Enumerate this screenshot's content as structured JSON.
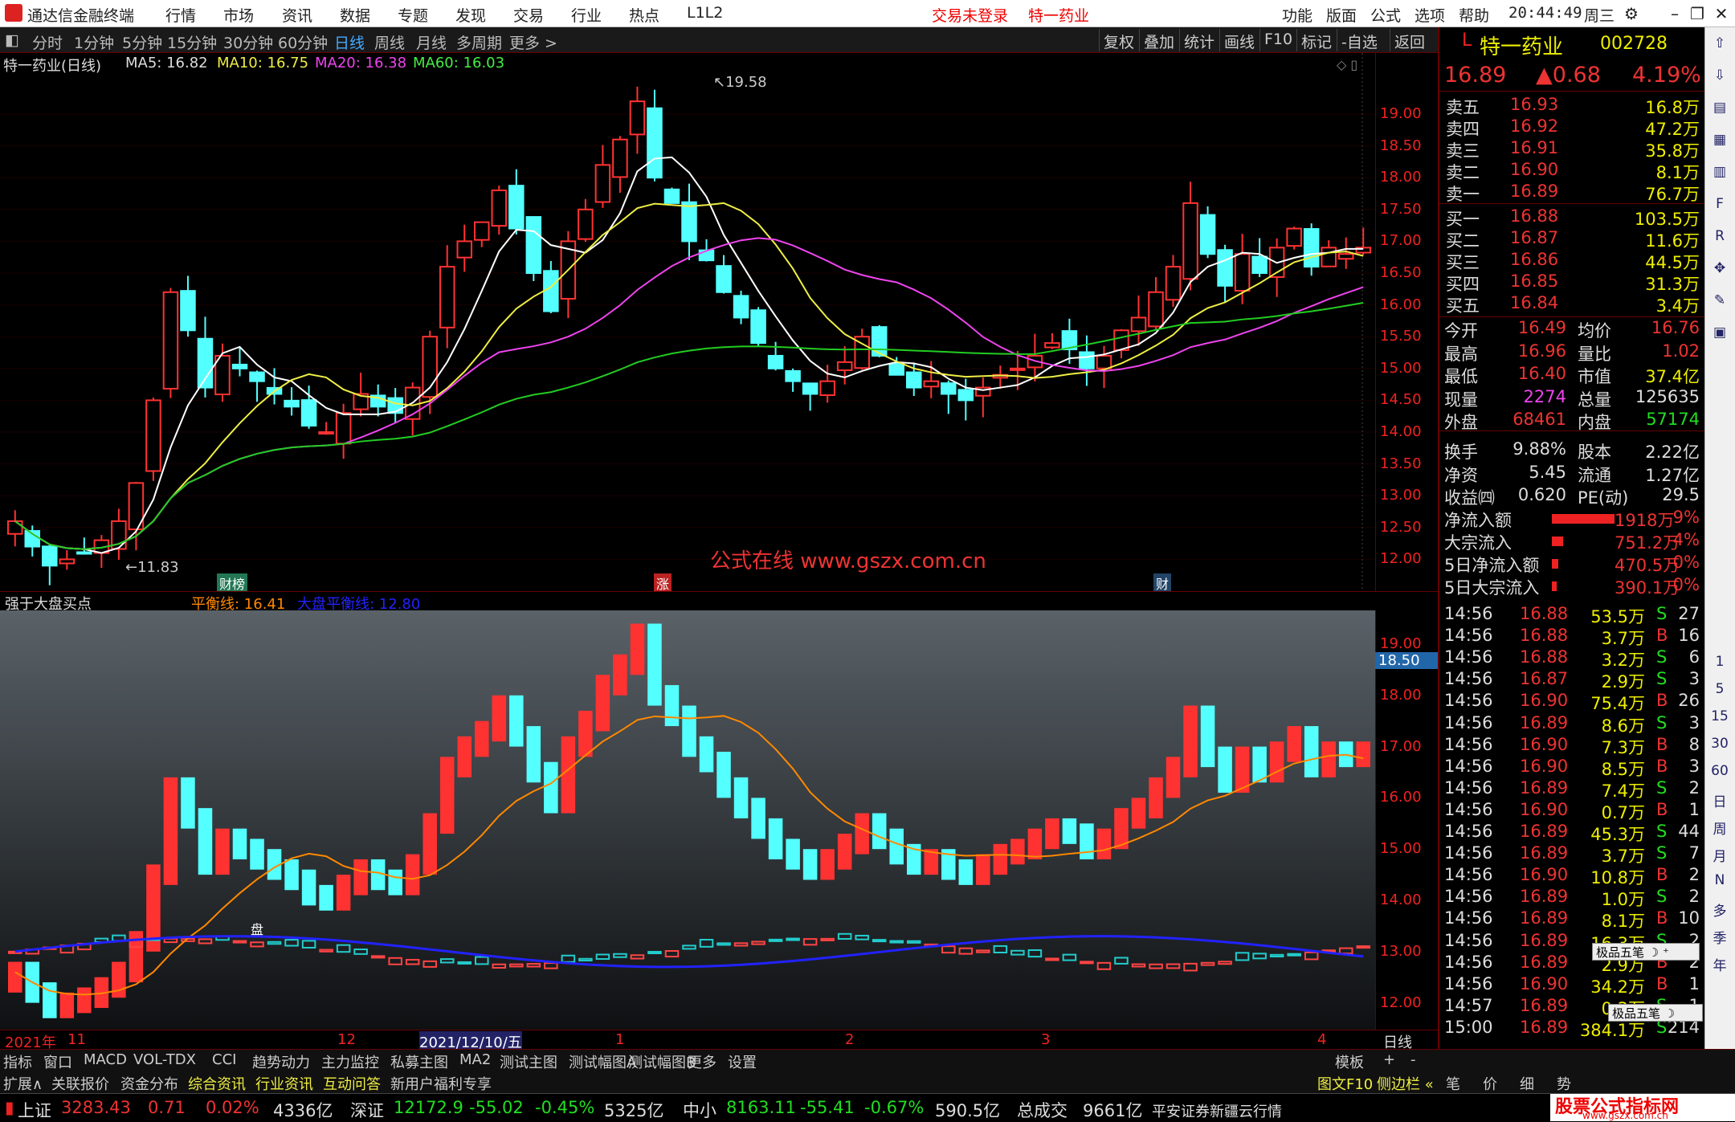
{
  "titlebar": {
    "app": "通达信金融终端",
    "menus": [
      "行情",
      "市场",
      "资讯",
      "数据",
      "专题",
      "发现",
      "交易",
      "行业",
      "热点",
      "L1L2"
    ],
    "notice": "交易未登录",
    "stock_tag": "特一药业",
    "right_menus": [
      "功能",
      "版面",
      "公式",
      "选项",
      "帮助"
    ],
    "time": "20:44:49",
    "weekday": "周三"
  },
  "periods": [
    "分时",
    "1分钟",
    "5分钟",
    "15分钟",
    "30分钟",
    "60分钟",
    "日线",
    "周线",
    "月线",
    "多周期",
    "更多 >"
  ],
  "tools": [
    "复权",
    "叠加",
    "统计",
    "画线",
    "F10",
    "标记",
    "-自选",
    "返回"
  ],
  "main": {
    "stock": "特一药业(日线)",
    "ma5": "MA5: 16.82",
    "ma10": "MA10: 16.75",
    "ma20": "MA20: 16.38",
    "ma60": "MA60: 16.03",
    "high_label": "19.58",
    "low_label": "11.83",
    "watermark": "公式在线  www.gszx.com.cn",
    "markers": [
      "财榜",
      "涨",
      "财"
    ],
    "axis": [
      "19.00",
      "18.50",
      "18.00",
      "17.50",
      "17.00",
      "16.50",
      "16.00",
      "15.50",
      "15.00",
      "14.50",
      "14.00",
      "13.50",
      "13.00",
      "12.50",
      "12.00"
    ]
  },
  "indicator": {
    "name": "强于大盘买点",
    "balance": "平衡线: 16.41",
    "market": "大盘平衡线: 12.80",
    "axis": [
      "19.00",
      "18.00",
      "17.00",
      "16.00",
      "15.00",
      "14.00",
      "13.00",
      "12.00"
    ],
    "cursor_price": "18.50",
    "pan_label": "盘"
  },
  "dates": {
    "year": "2021年",
    "m11": "11",
    "m12": "12",
    "cursor": "2021/12/10/五",
    "m1": "1",
    "m2": "2",
    "m3": "3",
    "m4": "4",
    "period": "日线"
  },
  "quote": {
    "prefix": "L",
    "name": "特一药业",
    "code": "002728",
    "price": "16.89",
    "change": "▲0.68",
    "pct": "4.19%",
    "asks": [
      [
        "卖五",
        "16.93",
        "16.8万"
      ],
      [
        "卖四",
        "16.92",
        "47.2万"
      ],
      [
        "卖三",
        "16.91",
        "35.8万"
      ],
      [
        "卖二",
        "16.90",
        "8.1万"
      ],
      [
        "卖一",
        "16.89",
        "76.7万"
      ]
    ],
    "bids": [
      [
        "买一",
        "16.88",
        "103.5万"
      ],
      [
        "买二",
        "16.87",
        "11.6万"
      ],
      [
        "买三",
        "16.86",
        "44.5万"
      ],
      [
        "买四",
        "16.85",
        "31.3万"
      ],
      [
        "买五",
        "16.84",
        "3.4万"
      ]
    ],
    "stats": [
      [
        "今开",
        "16.49",
        "均价",
        "16.76"
      ],
      [
        "最高",
        "16.96",
        "量比",
        "1.02"
      ],
      [
        "最低",
        "16.40",
        "市值",
        "37.4亿"
      ],
      [
        "现量",
        "2274",
        "总量",
        "125635"
      ],
      [
        "外盘",
        "68461",
        "内盘",
        "57174"
      ],
      [
        "换手",
        "9.88%",
        "股本",
        "2.22亿"
      ],
      [
        "净资",
        "5.45",
        "流通",
        "1.27亿"
      ],
      [
        "收益㈣",
        "0.620",
        "PE(动)",
        "29.5"
      ]
    ],
    "flows": [
      [
        "净流入额",
        "1918万",
        "9%"
      ],
      [
        "大宗流入",
        "751.2万",
        "4%"
      ],
      [
        "5日净流入额",
        "470.5万",
        "0%"
      ],
      [
        "5日大宗流入",
        "390.1万",
        "0%"
      ]
    ],
    "ticks": [
      [
        "14:56",
        "16.88",
        "53.5万",
        "S",
        "27"
      ],
      [
        "14:56",
        "16.88",
        "3.7万",
        "B",
        "16"
      ],
      [
        "14:56",
        "16.88",
        "3.2万",
        "S",
        "6"
      ],
      [
        "14:56",
        "16.87",
        "2.9万",
        "S",
        "3"
      ],
      [
        "14:56",
        "16.90",
        "75.4万",
        "B",
        "26"
      ],
      [
        "14:56",
        "16.89",
        "8.6万",
        "S",
        "3"
      ],
      [
        "14:56",
        "16.90",
        "7.3万",
        "B",
        "8"
      ],
      [
        "14:56",
        "16.90",
        "8.5万",
        "B",
        "3"
      ],
      [
        "14:56",
        "16.89",
        "7.4万",
        "S",
        "2"
      ],
      [
        "14:56",
        "16.90",
        "0.7万",
        "B",
        "1"
      ],
      [
        "14:56",
        "16.89",
        "45.3万",
        "S",
        "44"
      ],
      [
        "14:56",
        "16.89",
        "3.7万",
        "S",
        "7"
      ],
      [
        "14:56",
        "16.90",
        "10.8万",
        "B",
        "2"
      ],
      [
        "14:56",
        "16.89",
        "1.0万",
        "S",
        "2"
      ],
      [
        "14:56",
        "16.89",
        "8.1万",
        "B",
        "10"
      ],
      [
        "14:56",
        "16.89",
        "16.3万",
        "S",
        "2"
      ],
      [
        "14:56",
        "16.89",
        "2.9万",
        "B",
        "2"
      ],
      [
        "14:56",
        "16.90",
        "34.2万",
        "B",
        "1"
      ],
      [
        "14:57",
        "16.89",
        "0.3万",
        "S",
        "1"
      ],
      [
        "15:00",
        "16.89",
        "384.1万",
        "S",
        "214"
      ]
    ],
    "wubi": "极品五笔"
  },
  "tabs": [
    "指标",
    "窗口",
    "MACD",
    "VOL-TDX",
    "CCI",
    "趋势动力",
    "主力监控",
    "私募主图",
    "MA2",
    "测试主图",
    "测试幅图A",
    "测试幅图B",
    "更多",
    "设置"
  ],
  "tabs_right": [
    "模板",
    "+",
    "-"
  ],
  "tabs2": [
    "扩展∧",
    "关联报价",
    "资金分布",
    "综合资讯",
    "行业资讯",
    "互动问答",
    "新用户福利专享"
  ],
  "rbottom": [
    "图文F10",
    "侧边栏 «",
    "笔",
    "价",
    "细",
    "势"
  ],
  "status": {
    "sh_name": "上证",
    "sh": "3283.43",
    "sh_chg": "0.71",
    "sh_pct": "0.02%",
    "sh_amt": "4336亿",
    "sz_name": "深证",
    "sz": "12172.9",
    "sz_chg": "-55.02",
    "sz_pct": "-0.45%",
    "sz_amt": "5325亿",
    "zx_name": "中小",
    "zx": "8163.11",
    "zx_chg": "-55.41",
    "zx_pct": "-0.67%",
    "zx_amt": "590.5亿",
    "total_name": "总成交",
    "total": "9661亿",
    "broker": "平安证券新疆云行情",
    "site": "股票公式指标网",
    "site_url": "www.gszx.com.cn"
  },
  "side_icons": [
    "up-icon",
    "down-icon",
    "chart-icon",
    "grid-icon",
    "fund-icon",
    "f10-icon",
    "rsi-icon",
    "move-icon",
    "pen-icon",
    "fs-icon"
  ],
  "side_labels": [
    "1",
    "5",
    "15",
    "30",
    "60",
    "日",
    "周",
    "月",
    "N",
    "多",
    "季",
    "年"
  ]
}
